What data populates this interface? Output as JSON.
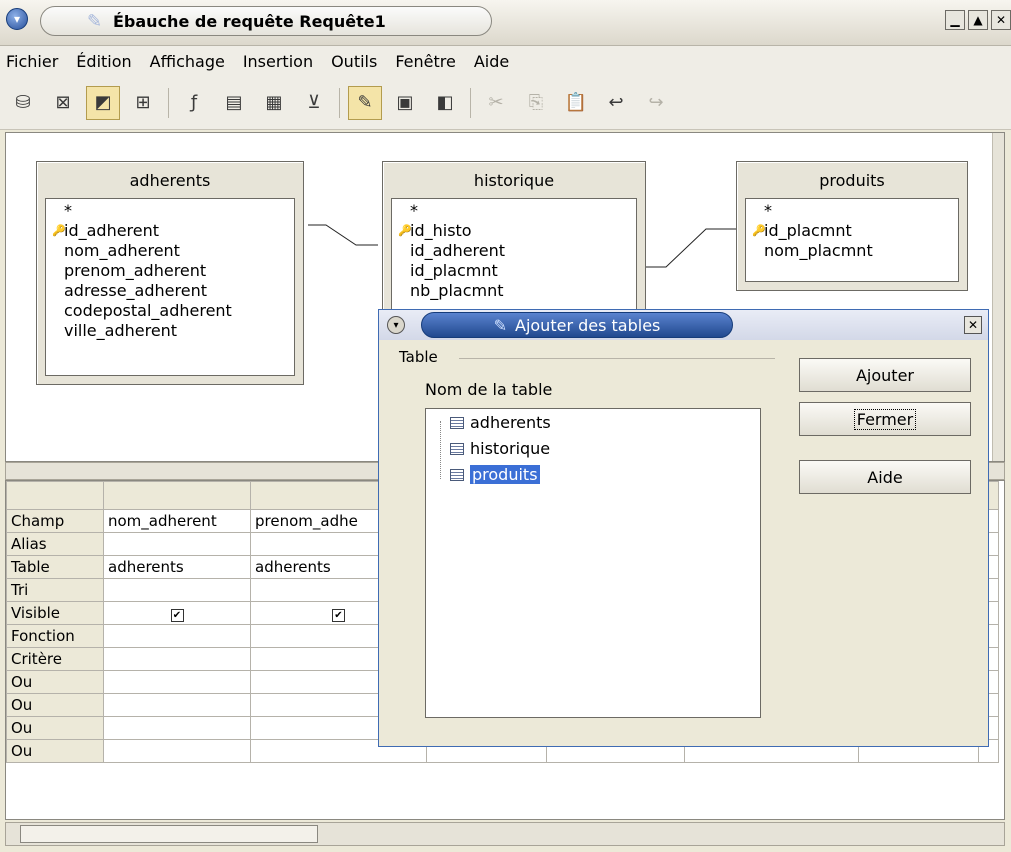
{
  "window": {
    "title": "Ébauche de requête Requête1"
  },
  "menu": [
    "Fichier",
    "Édition",
    "Affichage",
    "Insertion",
    "Outils",
    "Fenêtre",
    "Aide"
  ],
  "design": {
    "tables": [
      {
        "name": "adherents",
        "fields": [
          {
            "name": "*",
            "key": false
          },
          {
            "name": "id_adherent",
            "key": true
          },
          {
            "name": "nom_adherent",
            "key": false
          },
          {
            "name": "prenom_adherent",
            "key": false
          },
          {
            "name": "adresse_adherent",
            "key": false
          },
          {
            "name": "codepostal_adherent",
            "key": false
          },
          {
            "name": "ville_adherent",
            "key": false
          }
        ]
      },
      {
        "name": "historique",
        "fields": [
          {
            "name": "*",
            "key": false
          },
          {
            "name": "id_histo",
            "key": true
          },
          {
            "name": "id_adherent",
            "key": false
          },
          {
            "name": "id_placmnt",
            "key": false
          },
          {
            "name": "nb_placmnt",
            "key": false
          }
        ]
      },
      {
        "name": "produits",
        "fields": [
          {
            "name": "*",
            "key": false
          },
          {
            "name": "id_placmnt",
            "key": true
          },
          {
            "name": "nom_placmnt",
            "key": false
          }
        ]
      }
    ]
  },
  "grid": {
    "row_labels": [
      "Champ",
      "Alias",
      "Table",
      "Tri",
      "Visible",
      "Fonction",
      "Critère",
      "Ou",
      "Ou",
      "Ou",
      "Ou"
    ],
    "columns": [
      {
        "champ": "nom_adherent",
        "alias": "",
        "table": "adherents",
        "visible": true
      },
      {
        "champ": "prenom_adhe",
        "alias": "",
        "table": "adherents",
        "visible": true
      }
    ]
  },
  "dialog": {
    "title": "Ajouter des tables",
    "group_label": "Table",
    "list_label": "Nom de la table",
    "tables": [
      "adherents",
      "historique",
      "produits"
    ],
    "selected": "produits",
    "buttons": {
      "add": "Ajouter",
      "close": "Fermer",
      "help": "Aide"
    }
  }
}
